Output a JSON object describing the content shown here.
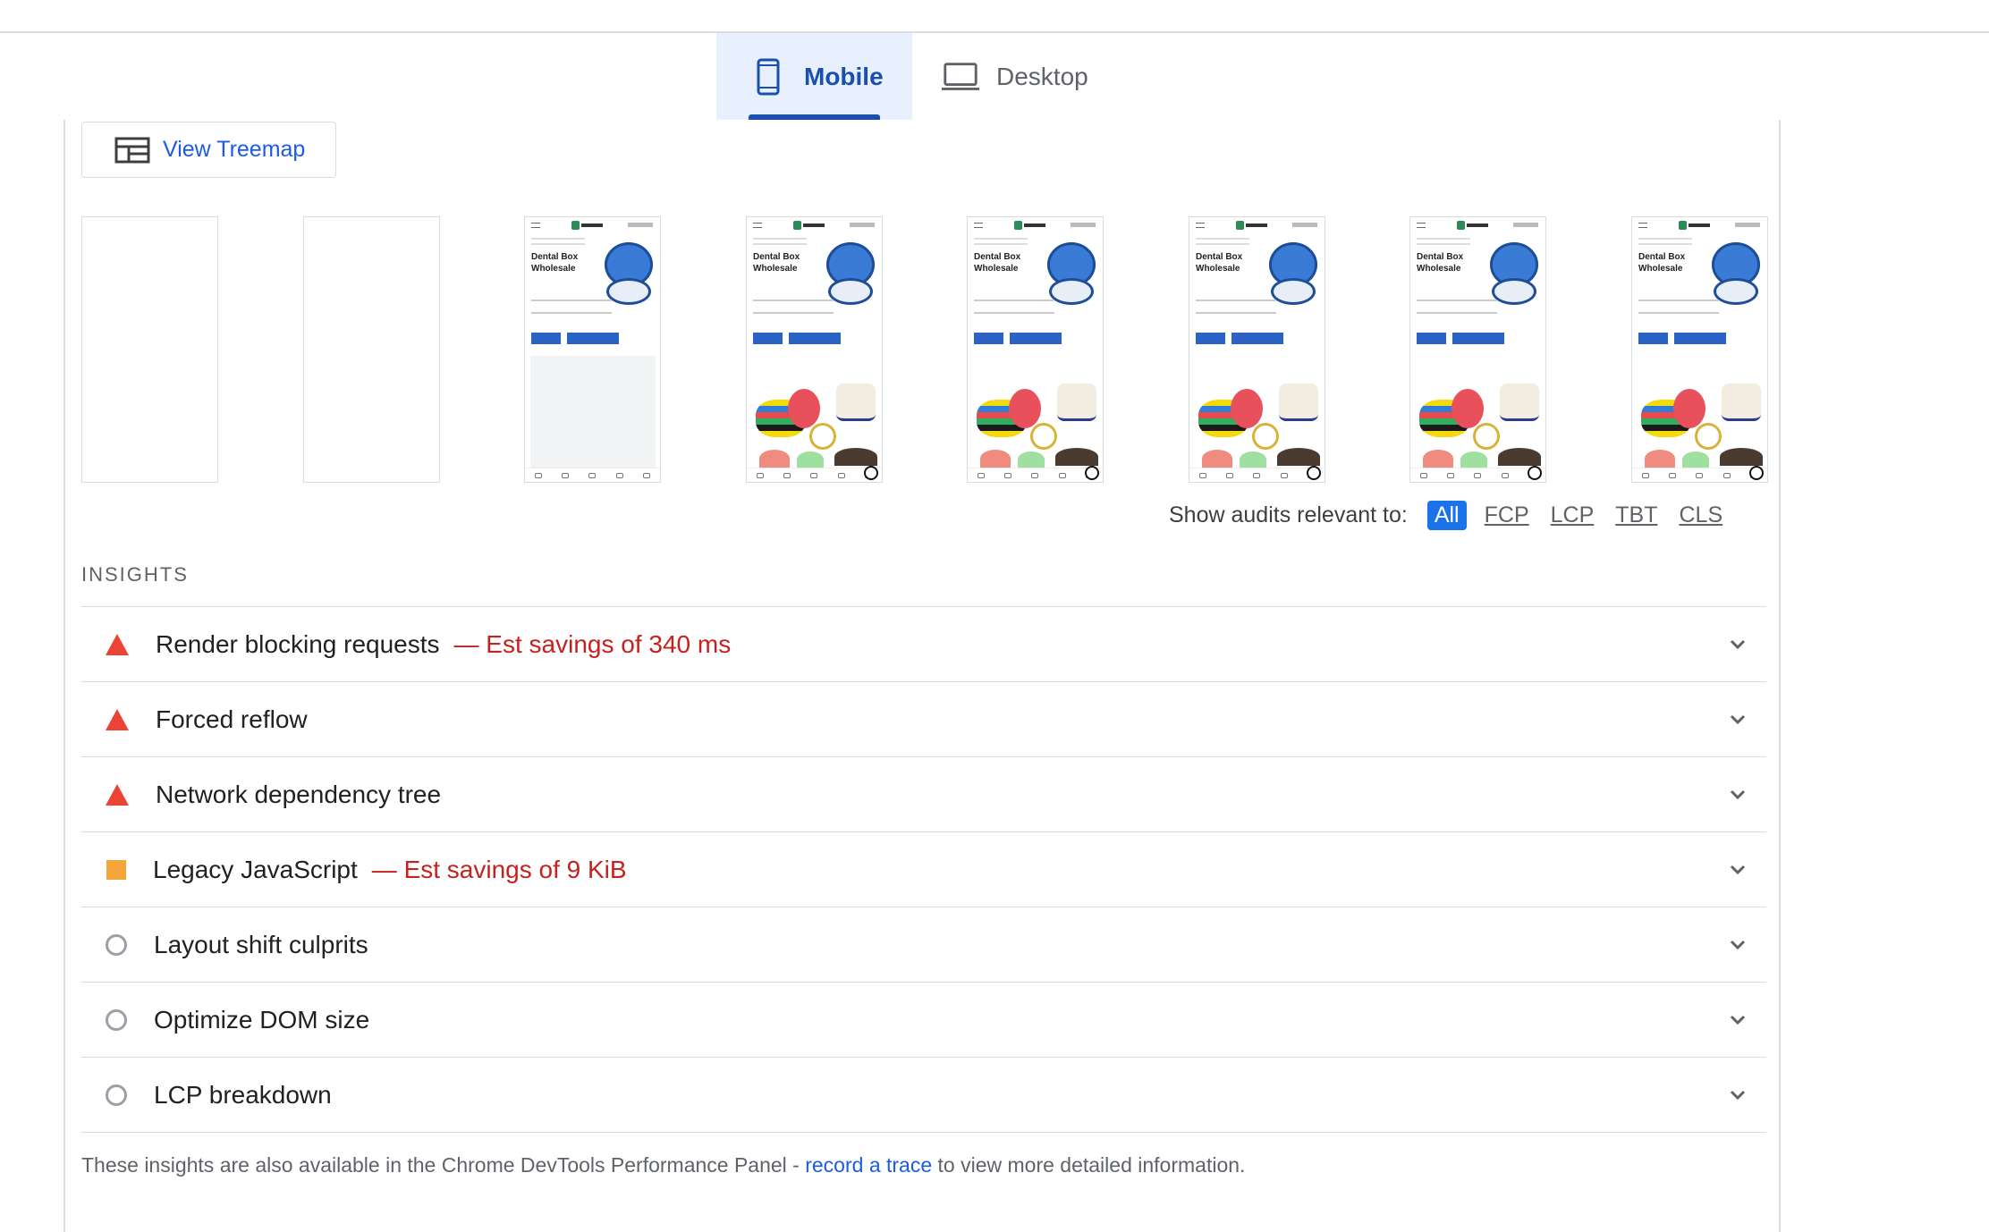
{
  "tabs": {
    "mobile_label": "Mobile",
    "desktop_label": "Desktop"
  },
  "treemap": {
    "label": "View Treemap"
  },
  "filmstrip": {
    "frame_heading": "Dental Box Wholesale",
    "frames_blank": 2,
    "frames_total": 8
  },
  "audit_filter": {
    "label": "Show audits relevant to:",
    "chips": [
      "All",
      "FCP",
      "LCP",
      "TBT",
      "CLS"
    ],
    "active": "All"
  },
  "insights": {
    "heading": "INSIGHTS",
    "items": [
      {
        "title": "Render blocking requests",
        "savings": "— Est savings of 340 ms",
        "severity": "fail"
      },
      {
        "title": "Forced reflow",
        "savings": "",
        "severity": "fail"
      },
      {
        "title": "Network dependency tree",
        "savings": "",
        "severity": "fail"
      },
      {
        "title": "Legacy JavaScript",
        "savings": "— Est savings of 9 KiB",
        "severity": "average"
      },
      {
        "title": "Layout shift culprits",
        "savings": "",
        "severity": "informative"
      },
      {
        "title": "Optimize DOM size",
        "savings": "",
        "severity": "informative"
      },
      {
        "title": "LCP breakdown",
        "savings": "",
        "severity": "informative"
      }
    ]
  },
  "footer": {
    "prefix": "These insights are also available in the Chrome DevTools Performance Panel - ",
    "link": "record a trace",
    "suffix": " to view more detailed information."
  },
  "colors": {
    "accent": "#1a4fae",
    "link": "#1a5ce6",
    "fail": "#eb4335",
    "average": "#f4a63a",
    "savings": "#c5221f"
  }
}
